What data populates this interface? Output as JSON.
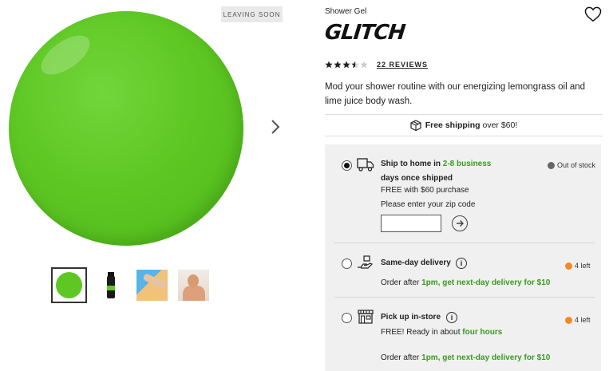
{
  "gallery": {
    "badge": "LEAVING SOON",
    "thumbnails": [
      "gel-swatch",
      "bottle",
      "arm-pour",
      "person-shower"
    ]
  },
  "product": {
    "category": "Shower Gel",
    "name": "GLITCH",
    "rating": 3.5,
    "reviews_label": "22 REVIEWS",
    "description": "Mod your shower routine with our energizing lemongrass oil and lime juice body wash."
  },
  "shipping_bar": {
    "bold": "Free shipping",
    "rest": "over $60!"
  },
  "delivery": {
    "ship_home": {
      "title_prefix": "Ship to home in ",
      "title_green_1": "2-8 business",
      "title_green_2": "days once shipped",
      "free_line": "FREE with $60 purchase",
      "zip_prompt": "Please enter your zip code",
      "zip_value": "",
      "stock": "Out of stock",
      "stock_color": "#666666"
    },
    "same_day": {
      "title": "Same-day delivery",
      "line_prefix": "Order after ",
      "line_time": "1pm",
      "line_suffix": ", get next-day delivery for $10",
      "stock": "4 left",
      "stock_color": "#f08a24"
    },
    "pickup": {
      "title": "Pick up in-store",
      "line_prefix": "FREE! Ready in about ",
      "line_green": "four hours",
      "stock": "4 left",
      "stock_color": "#f08a24",
      "footer_prefix": "Order after ",
      "footer_time": "1pm",
      "footer_suffix": ", get next-day delivery for $10"
    }
  },
  "colors": {
    "accent_green": "#3a9a1f",
    "gel_green": "#5ec724",
    "panel_bg": "#f0f0f0"
  }
}
